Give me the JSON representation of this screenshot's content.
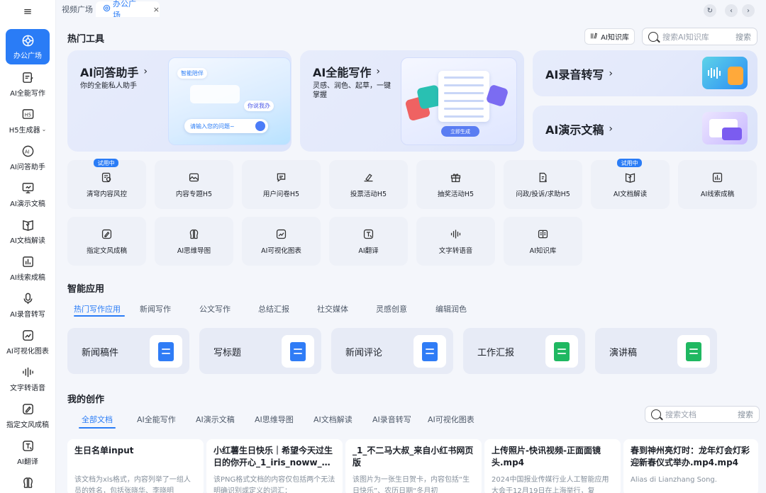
{
  "tabs": {
    "t1": "视频广场",
    "t2": "办公广场",
    "close": "×"
  },
  "sidebar": {
    "items": [
      {
        "label": "办公广场"
      },
      {
        "label": "AI全能写作"
      },
      {
        "label": "H5生成器"
      },
      {
        "label": "AI问答助手"
      },
      {
        "label": "AI演示文稿"
      },
      {
        "label": "AI文档解读"
      },
      {
        "label": "AI线索成稿"
      },
      {
        "label": "AI录音转写"
      },
      {
        "label": "AI可视化图表"
      },
      {
        "label": "文字转语音"
      },
      {
        "label": "指定文风成稿"
      },
      {
        "label": "AI翻译"
      }
    ]
  },
  "hot": {
    "title": "热门工具",
    "kb_label": "AI知识库",
    "search_placeholder": "搜索AI知识库",
    "search_btn": "搜索"
  },
  "big_cards": {
    "qa_title": "AI问答助手",
    "qa_desc": "你的全能私人助手",
    "qa_pill1": "智能陪伴",
    "qa_pill2": "你说我办",
    "qa_input": "请输入您的问题~",
    "write_title": "AI全能写作",
    "write_desc": "灵感、润色、起草，一键掌握",
    "write_gen": "立即生成",
    "rec_title": "AI录音转写",
    "ppt_title": "AI演示文稿"
  },
  "tools": {
    "badge": "试用中",
    "row1": [
      "清穹内容风控",
      "内容专题H5",
      "用户问卷H5",
      "投票活动H5",
      "抽奖活动H5",
      "问政/投诉/求助H5",
      "AI文档解读",
      "AI线索成稿"
    ],
    "row2": [
      "指定文风成稿",
      "AI思维导图",
      "AI可视化图表",
      "AI翻译",
      "文字转语音",
      "AI知识库"
    ]
  },
  "apps": {
    "title": "智能应用",
    "tabs": [
      "热门写作应用",
      "新闻写作",
      "公文写作",
      "总结汇报",
      "社交媒体",
      "灵感创意",
      "编辑润色"
    ],
    "cards": [
      "新闻稿件",
      "写标题",
      "新闻评论",
      "工作汇报",
      "演讲稿"
    ]
  },
  "creations": {
    "title": "我的创作",
    "tabs": [
      "全部文档",
      "AI全能写作",
      "AI演示文稿",
      "AI思维导图",
      "AI文档解读",
      "AI录音转写",
      "AI可视化图表"
    ],
    "search_placeholder": "搜索文档",
    "search_btn": "搜索",
    "cards": [
      {
        "title": "生日名单input",
        "desc": "该文档为xls格式，内容列举了一组人员的姓名，包括张晓华、李晓明"
      },
      {
        "title": "小红薯生日快乐｜希望今天过生日的你开心_1_iris_noww_…",
        "desc": "该PNG格式文档的内容仅包括两个无法明确识别或定义的词汇："
      },
      {
        "title": "_1_不二马大叔_来自小红书网页版",
        "desc": "该图片为一张生日贺卡，内容包括“生日快乐”、农历日期“冬月初"
      },
      {
        "title": "上传照片-快讯视频-正面面镜头.mp4",
        "desc": "2024中国报业传媒行业人工智能应用大会于12月19日在上海举行，复"
      },
      {
        "title": "春到神州亮灯时：龙年灯会灯彩迎新春仪式举办.mp4.mp4",
        "desc": "Alias di Lianzhang Song."
      }
    ]
  }
}
